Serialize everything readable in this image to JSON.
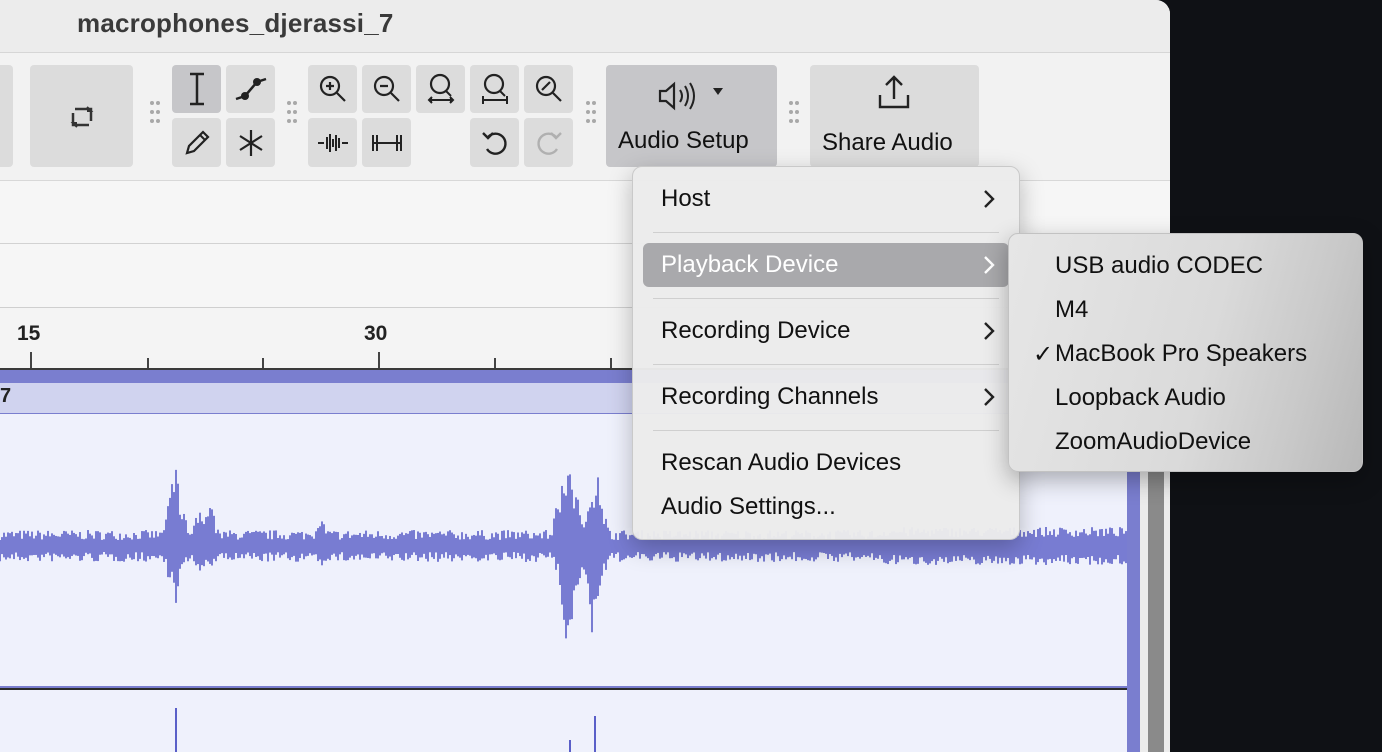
{
  "window": {
    "title": "macrophones_djerassi_7"
  },
  "toolbar": {
    "audio_setup_label": "Audio Setup",
    "share_audio_label": "Share Audio"
  },
  "ruler": {
    "labels": [
      "15",
      "30"
    ]
  },
  "track": {
    "number": "7"
  },
  "audio_setup_menu": {
    "items": [
      {
        "label": "Host",
        "has_submenu": true
      },
      {
        "label": "Playback Device",
        "has_submenu": true,
        "highlighted": true
      },
      {
        "label": "Recording Device",
        "has_submenu": true
      },
      {
        "label": "Recording Channels",
        "has_submenu": true
      },
      {
        "label": "Rescan Audio Devices",
        "has_submenu": false
      },
      {
        "label": "Audio Settings...",
        "has_submenu": false
      }
    ]
  },
  "playback_device_submenu": {
    "items": [
      {
        "label": "USB audio CODEC",
        "checked": false
      },
      {
        "label": "M4",
        "checked": false
      },
      {
        "label": "MacBook Pro Speakers",
        "checked": true
      },
      {
        "label": "Loopback Audio",
        "checked": false
      },
      {
        "label": "ZoomAudioDevice",
        "checked": false
      }
    ],
    "check_glyph": "✓"
  },
  "colors": {
    "waveform": "#5a5fc8",
    "track_background": "#eff1fc",
    "menu_highlight": "#a9a9ac"
  },
  "icons": [
    "loop-icon",
    "selection-tool-icon",
    "envelope-tool-icon",
    "draw-tool-icon",
    "multi-tool-icon",
    "zoom-in-icon",
    "zoom-out-icon",
    "fit-selection-icon",
    "fit-project-icon",
    "zoom-toggle-icon",
    "trim-icon",
    "silence-icon",
    "undo-icon",
    "redo-icon",
    "speaker-icon",
    "share-icon"
  ]
}
